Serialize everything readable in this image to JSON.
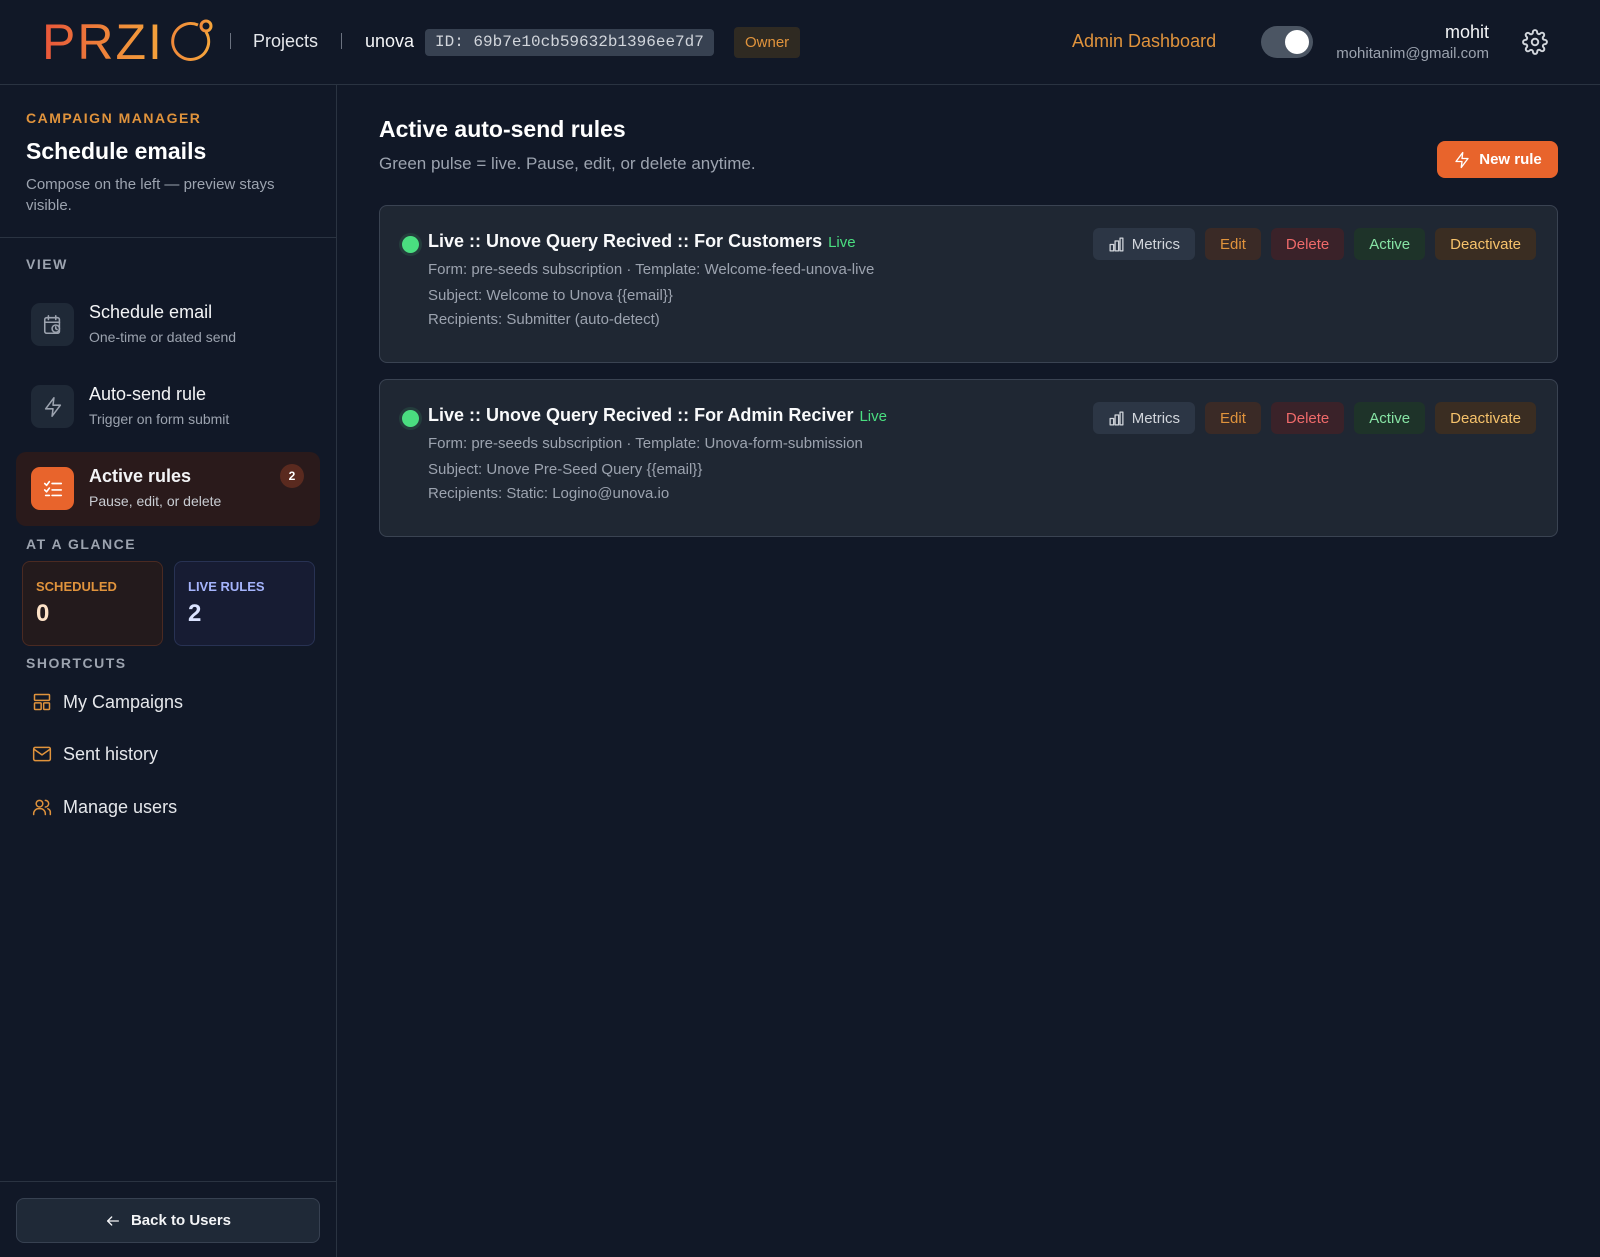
{
  "header": {
    "logo_text": "PRZI",
    "nav_projects": "Projects",
    "project_name": "unova",
    "project_id": "ID: 69b7e10cb59632b1396ee7d7",
    "role": "Owner",
    "admin_link": "Admin Dashboard",
    "user_name": "mohit",
    "user_email": "mohitanim@gmail.com"
  },
  "sidebar": {
    "eyebrow": "CAMPAIGN MANAGER",
    "title": "Schedule emails",
    "description": "Compose on the left — preview stays visible.",
    "view_label": "VIEW",
    "items": [
      {
        "title": "Schedule email",
        "subtitle": "One-time or dated send",
        "icon": "calendar-clock-icon"
      },
      {
        "title": "Auto-send rule",
        "subtitle": "Trigger on form submit",
        "icon": "lightning-icon"
      },
      {
        "title": "Active rules",
        "subtitle": "Pause, edit, or delete",
        "icon": "checklist-icon",
        "badge": "2",
        "active": true
      }
    ],
    "glance_label": "AT A GLANCE",
    "stats": {
      "scheduled_label": "SCHEDULED",
      "scheduled_value": "0",
      "live_label": "LIVE RULES",
      "live_value": "2"
    },
    "shortcuts_label": "SHORTCUTS",
    "shortcuts": [
      {
        "label": "My Campaigns",
        "icon": "layout-icon"
      },
      {
        "label": "Sent history",
        "icon": "mail-icon"
      },
      {
        "label": "Manage users",
        "icon": "users-icon"
      }
    ],
    "back_button": "Back to Users"
  },
  "main": {
    "title": "Active auto-send rules",
    "subtitle": "Green pulse = live. Pause, edit, or delete anytime.",
    "new_rule_button": "New rule",
    "actions": {
      "metrics": "Metrics",
      "edit": "Edit",
      "delete": "Delete",
      "active": "Active",
      "deactivate": "Deactivate"
    },
    "rules": [
      {
        "title": "Live :: Unove Query Recived :: For Customers",
        "status": "Live",
        "form_line": "Form: pre-seeds subscription · Template: Welcome-feed-unova-live",
        "subject_line": "Subject: Welcome to Unova {{email}}",
        "recipients_line": "Recipients: Submitter (auto-detect)"
      },
      {
        "title": "Live :: Unove Query Recived :: For Admin Reciver",
        "status": "Live",
        "form_line": "Form: pre-seeds subscription · Template: Unova-form-submission",
        "subject_line": "Subject: Unove Pre-Seed Query {{email}}",
        "recipients_line": "Recipients: Static: Logino@unova.io"
      }
    ]
  },
  "colors": {
    "background": "#111827",
    "accent": "#e8642c",
    "owner_text": "#e0933c",
    "live_green": "#4ade80"
  }
}
